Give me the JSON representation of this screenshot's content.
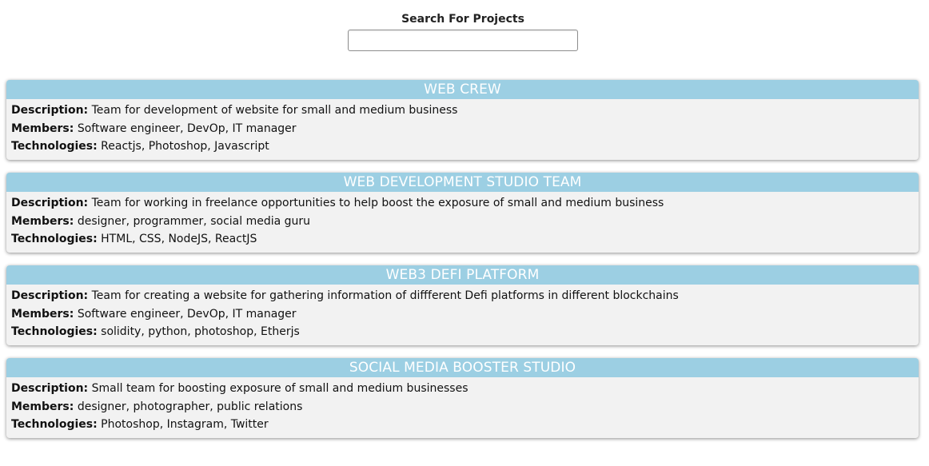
{
  "search": {
    "label": "Search For Projects",
    "value": "",
    "placeholder": ""
  },
  "labels": {
    "description": "Description:",
    "members": "Members:",
    "technologies": "Technologies:"
  },
  "projects": [
    {
      "title": "WEB CREW",
      "description": "Team for development of website for small and medium business",
      "members": "Software engineer, DevOp, IT manager",
      "technologies": "Reactjs, Photoshop, Javascript"
    },
    {
      "title": "WEB DEVELOPMENT STUDIO TEAM",
      "description": "Team for working in freelance opportunities to help boost the exposure of small and medium business",
      "members": "designer, programmer, social media guru",
      "technologies": "HTML, CSS, NodeJS, ReactJS"
    },
    {
      "title": "WEB3 DEFI PLATFORM",
      "description": "Team for creating a website for gathering information of diffferent Defi platforms in different blockchains",
      "members": "Software engineer, DevOp, IT manager",
      "technologies": "solidity, python, photoshop, Etherjs"
    },
    {
      "title": "SOCIAL MEDIA BOOSTER STUDIO",
      "description": "Small team for boosting exposure of small and medium businesses",
      "members": "designer, photographer, public relations",
      "technologies": "Photoshop, Instagram, Twitter"
    }
  ],
  "colors": {
    "card_header": "#9ccfe3",
    "card_body": "#f2f2f2",
    "header_text": "#ffffff"
  }
}
